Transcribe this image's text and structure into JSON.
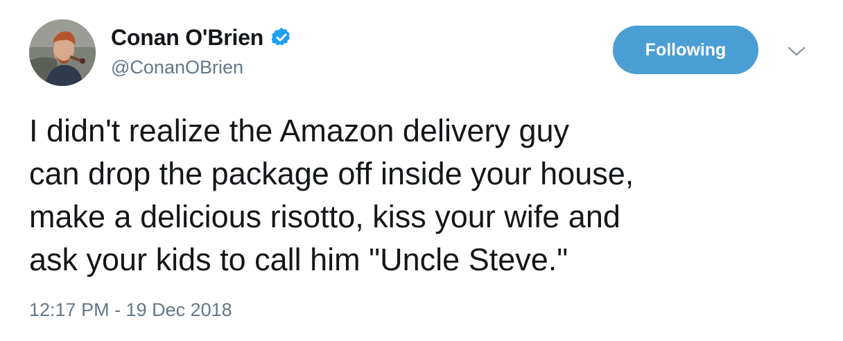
{
  "author": {
    "display_name": "Conan O'Brien",
    "handle": "@ConanOBrien",
    "verified": true,
    "verified_icon": "verified-badge-icon"
  },
  "actions": {
    "follow_label": "Following",
    "more_icon": "chevron-down-icon"
  },
  "tweet": {
    "lines": [
      "I didn't realize the Amazon delivery guy",
      "can drop the package off inside your house,",
      "make a delicious risotto, kiss your wife and",
      "ask your kids to call him \"Uncle Steve.\""
    ],
    "timestamp": "12:17 PM - 19 Dec 2018"
  },
  "colors": {
    "accent": "#4a9ed3",
    "verified": "#1da1f2",
    "muted_text": "#657786",
    "text": "#14171a"
  }
}
